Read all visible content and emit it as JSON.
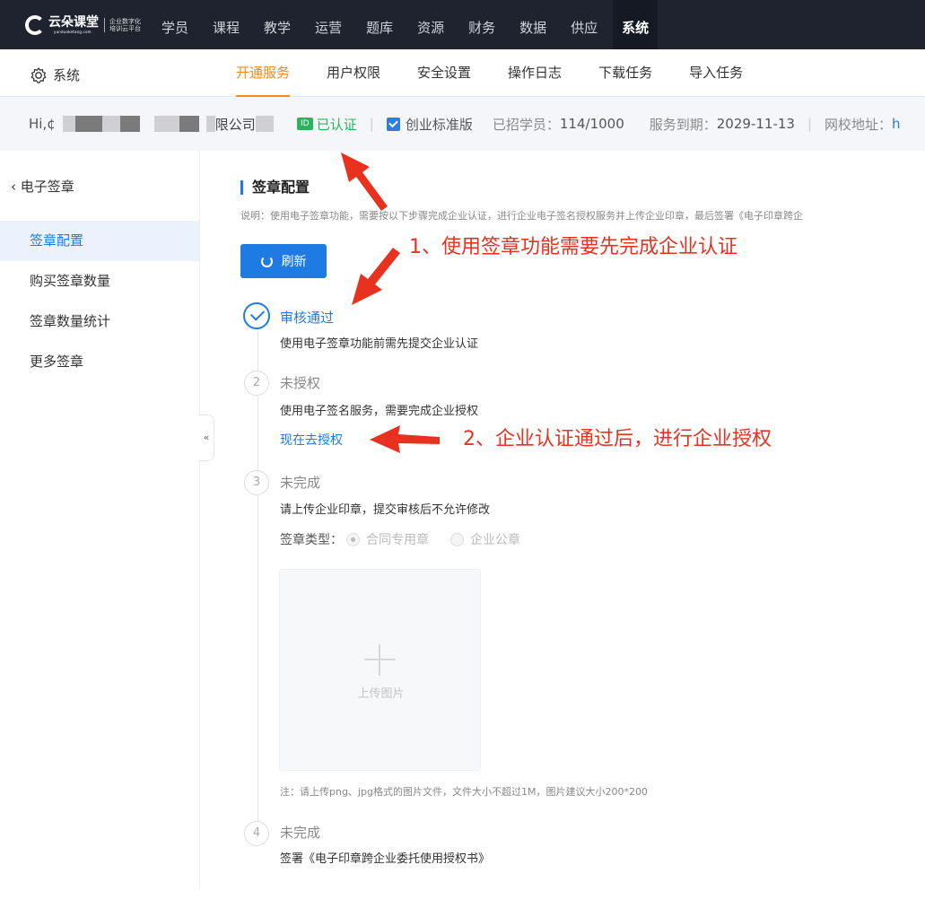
{
  "brand": {
    "name": "云朵课堂",
    "sub": "yunduoketang.com",
    "slogan_line1": "企业数字化",
    "slogan_line2": "培训云平台"
  },
  "topnav": {
    "items": [
      "学员",
      "课程",
      "教学",
      "运营",
      "题库",
      "资源",
      "财务",
      "数据",
      "供应",
      "系统"
    ],
    "active": "系统"
  },
  "subnav": {
    "title": "系统",
    "tabs": [
      "开通服务",
      "用户权限",
      "安全设置",
      "操作日志",
      "下载任务",
      "导入任务"
    ],
    "active": "开通服务"
  },
  "infobar": {
    "hi": "Hi,¢",
    "company_tail": "限公司",
    "verified": "已认证",
    "edition": "创业标准版",
    "students_label": "已招学员：",
    "students_value": "114/1000",
    "expiry_label": "服务到期：",
    "expiry_value": "2029-11-13",
    "site_label": "网校地址：",
    "site_value": "h",
    "separator": "|"
  },
  "sidebar": {
    "back_label": "电子签章",
    "items": [
      "签章配置",
      "购买签章数量",
      "签章数量统计",
      "更多签章"
    ],
    "active": "签章配置",
    "collapse": "«"
  },
  "main": {
    "title": "签章配置",
    "description": "说明：使用电子签章功能，需要按以下步骤完成企业认证，进行企业电子签名授权服务并上传企业印章，最后签署《电子印章跨企",
    "refresh_label": "刷新",
    "steps": [
      {
        "status": "审核通过",
        "desc": "使用电子签章功能前需先提交企业认证"
      },
      {
        "num": "2",
        "status": "未授权",
        "desc": "使用电子签名服务，需要完成企业授权",
        "link": "现在去授权"
      },
      {
        "num": "3",
        "status": "未完成",
        "desc": "请上传企业印章，提交审核后不允许修改"
      },
      {
        "num": "4",
        "status": "未完成",
        "desc": "签署《电子印章跨企业委托使用授权书》"
      }
    ],
    "seal_type_label": "签章类型：",
    "seal_options": [
      "合同专用章",
      "企业公章"
    ],
    "upload_label": "上传图片",
    "note": "注：请上传png、jpg格式的图片文件，文件大小不超过1M，图片建议大小200*200"
  },
  "annotations": {
    "note1": "1、使用签章功能需要先完成企业认证",
    "note2": "2、企业认证通过后，进行企业授权"
  },
  "colors": {
    "nav_bg": "#1f2330",
    "accent_orange": "#f08a24",
    "primary_blue": "#1e7be4",
    "verified_green": "#2bb35b",
    "annotation_red": "#e8321f"
  }
}
